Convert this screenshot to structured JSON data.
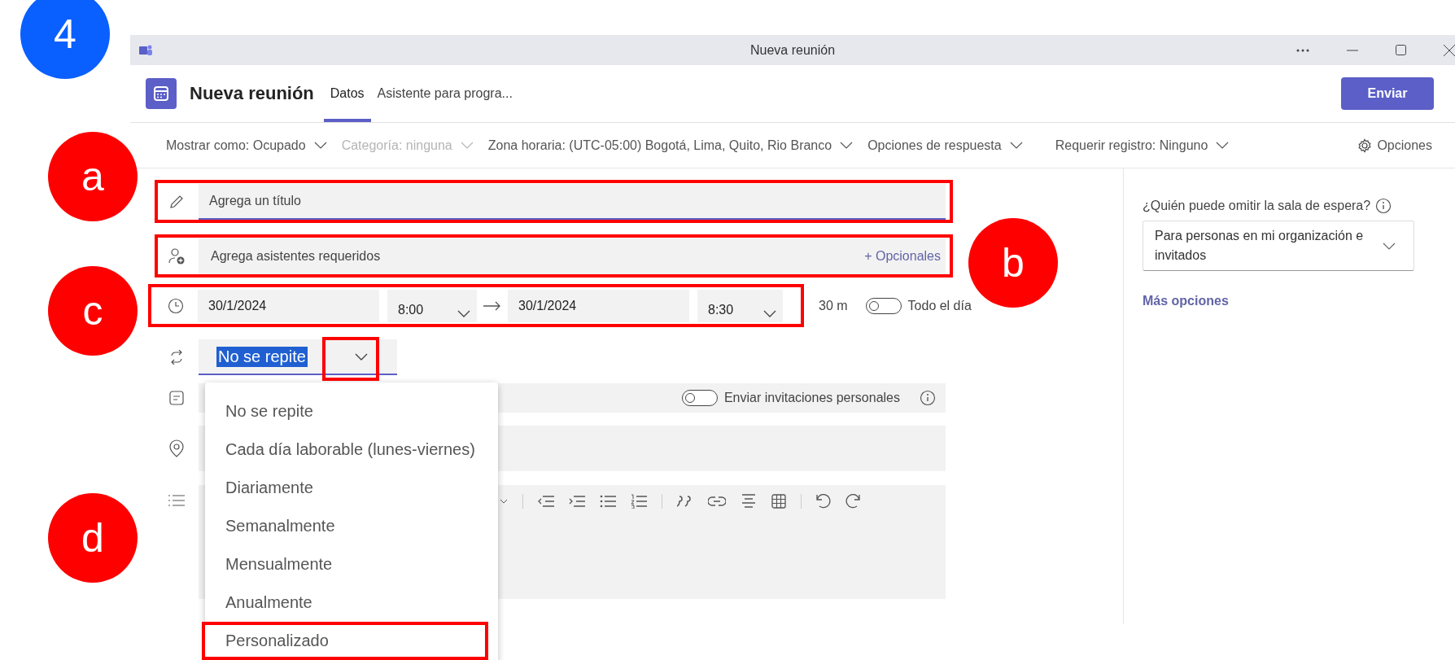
{
  "step_badge": "4",
  "annotations": [
    {
      "label": "a"
    },
    {
      "label": "b"
    },
    {
      "label": "c"
    },
    {
      "label": "d"
    }
  ],
  "window": {
    "title": "Nueva reunión"
  },
  "header": {
    "title": "Nueva reunión",
    "tabs": [
      {
        "label": "Datos",
        "selected": true
      },
      {
        "label": "Asistente para progra...",
        "selected": false
      }
    ],
    "send_button": "Enviar"
  },
  "options_bar": {
    "items": [
      {
        "label": "Mostrar como: Ocupado",
        "disabled": false
      },
      {
        "label": "Categoría: ninguna",
        "disabled": true
      },
      {
        "label": "Zona horaria: (UTC-05:00) Bogotá, Lima, Quito, Rio Branco",
        "disabled": false
      },
      {
        "label": "Opciones de respuesta",
        "disabled": false
      },
      {
        "label": "Requerir registro: Ninguno",
        "disabled": false
      }
    ],
    "settings": "Opciones"
  },
  "form": {
    "title_field": {
      "placeholder": "Agrega un título",
      "highlighted": true
    },
    "attendees_field": {
      "placeholder": "Agrega asistentes requeridos",
      "optional_link": "+ Opcionales",
      "highlighted": true
    },
    "date_row": {
      "start_date": "30/1/2024",
      "start_time": "8:00",
      "end_date": "30/1/2024",
      "end_time": "8:30",
      "highlighted": true
    },
    "duration": "30 m",
    "all_day": {
      "label": "Todo el día",
      "on": false
    },
    "repeat": {
      "value": "No se repite",
      "expanded": true,
      "chevron_highlighted": true,
      "options": [
        {
          "label": "No se repite",
          "highlighted": false
        },
        {
          "label": "Cada día laborable (lunes-viernes)",
          "highlighted": false
        },
        {
          "label": "Diariamente",
          "highlighted": false
        },
        {
          "label": "Semanalmente",
          "highlighted": false
        },
        {
          "label": "Mensualmente",
          "highlighted": false
        },
        {
          "label": "Anualmente",
          "highlighted": false
        },
        {
          "label": "Personalizado",
          "highlighted": true
        }
      ]
    },
    "personal_invites": {
      "label": "Enviar invitaciones personales",
      "on": false
    }
  },
  "side_panel": {
    "lobby_label": "¿Quién puede omitir la sala de espera?",
    "lobby_value": "Para personas en mi organización e invitados",
    "more_options": "Más opciones"
  }
}
